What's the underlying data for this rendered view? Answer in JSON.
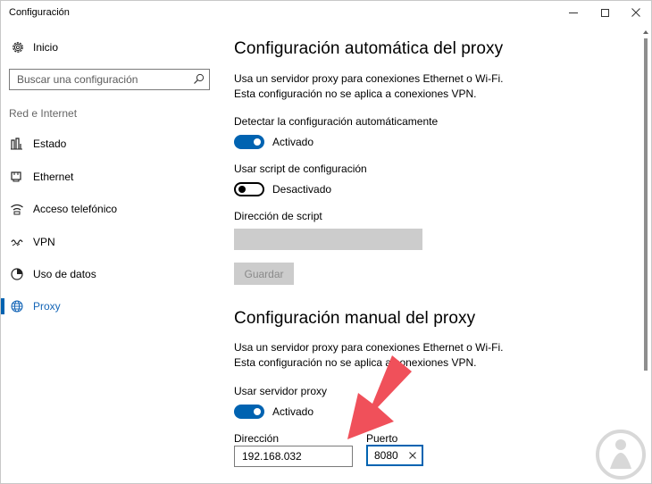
{
  "window": {
    "title": "Configuración",
    "controls": {
      "minimize": "minimize-icon",
      "maximize": "maximize-icon",
      "close": "close-icon"
    }
  },
  "sidebar": {
    "home_label": "Inicio",
    "search_placeholder": "Buscar una configuración",
    "section_label": "Red e Internet",
    "items": [
      {
        "label": "Estado",
        "icon": "status-icon"
      },
      {
        "label": "Ethernet",
        "icon": "ethernet-icon"
      },
      {
        "label": "Acceso telefónico",
        "icon": "dialup-icon"
      },
      {
        "label": "VPN",
        "icon": "vpn-icon"
      },
      {
        "label": "Uso de datos",
        "icon": "data-usage-icon"
      },
      {
        "label": "Proxy",
        "icon": "globe-icon",
        "selected": true
      }
    ],
    "accent_color": "#0063b1"
  },
  "auto_proxy": {
    "heading": "Configuración automática del proxy",
    "description": "Usa un servidor proxy para conexiones Ethernet o Wi-Fi. Esta configuración no se aplica a conexiones VPN.",
    "detect_label": "Detectar la configuración automáticamente",
    "detect_state": "Activado",
    "detect_on": true,
    "script_label": "Usar script de configuración",
    "script_state": "Desactivado",
    "script_on": false,
    "script_address_label": "Dirección de script",
    "script_address_value": "",
    "save_button": "Guardar"
  },
  "manual_proxy": {
    "heading": "Configuración manual del proxy",
    "description": "Usa un servidor proxy para conexiones Ethernet o Wi-Fi. Esta configuración no se aplica a conexiones VPN.",
    "use_proxy_label": "Usar servidor proxy",
    "use_proxy_state": "Activado",
    "use_proxy_on": true,
    "address_label": "Dirección",
    "address_value": "192.168.032",
    "port_label": "Puerto",
    "port_value": "8080"
  },
  "annotation": {
    "arrow_color": "#f0505a"
  }
}
